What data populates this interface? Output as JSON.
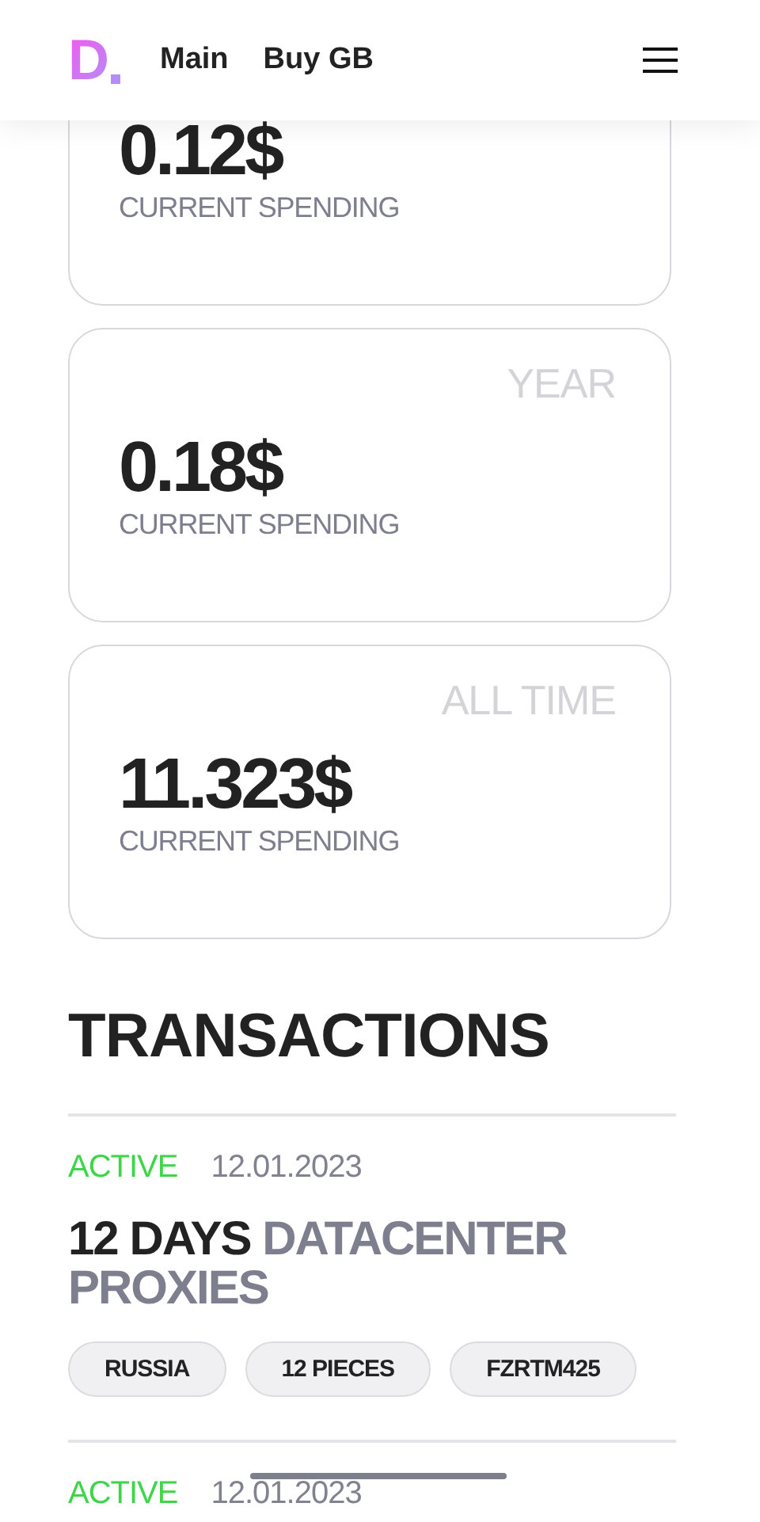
{
  "header": {
    "logo": "D",
    "nav": [
      {
        "label": "Main"
      },
      {
        "label": "Buy GB"
      }
    ]
  },
  "spending_cards": [
    {
      "amount": "0.12$",
      "caption": "CURRENT SPENDING"
    },
    {
      "period": "YEAR",
      "amount": "0.18$",
      "caption": "CURRENT SPENDING"
    },
    {
      "period": "ALL TIME",
      "amount": "11.323$",
      "caption": "CURRENT SPENDING"
    }
  ],
  "transactions": {
    "heading": "TRANSACTIONS",
    "items": [
      {
        "status": "ACTIVE",
        "color": "#3fd54a",
        "date": "12.01.2023",
        "duration": "12 DAYS",
        "product": "DATACENTER PROXIES",
        "tags": [
          "RUSSIA",
          "12 PIECES",
          "FZRTM425"
        ]
      },
      {
        "status": "ACTIVE",
        "color": "#3fd54a",
        "date": "12.01.2023"
      }
    ]
  }
}
